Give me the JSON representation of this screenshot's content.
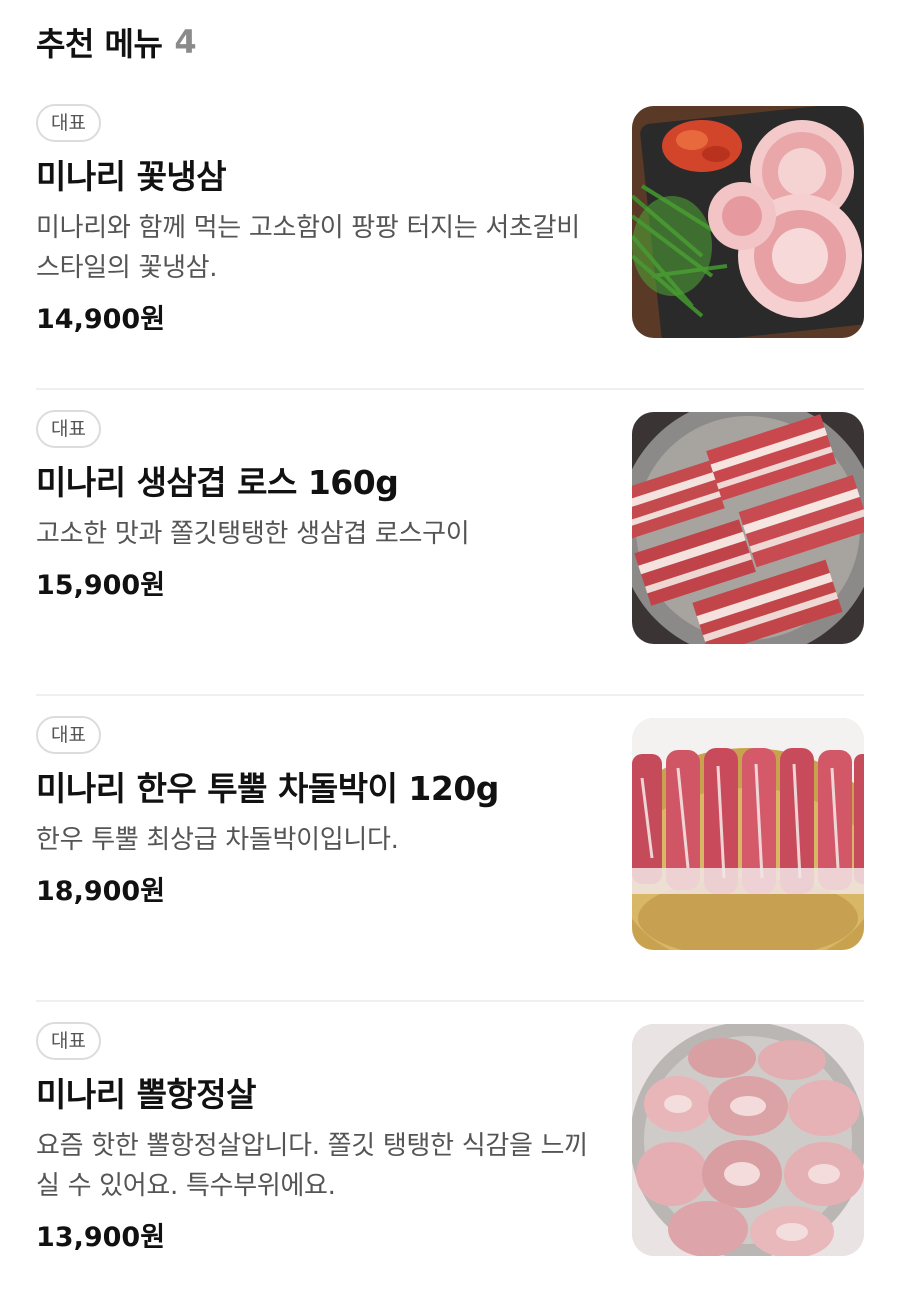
{
  "section": {
    "title": "추천 메뉴",
    "count": "4"
  },
  "menus": [
    {
      "badge": "대표",
      "name": "미나리 꽃냉삼",
      "desc": "미나리와 함께 먹는 고소함이 팡팡 터지는 서초갈비 스타일의 꽃냉삼.",
      "price": "14,900원",
      "image": "sliced-pork-with-minari-photo"
    },
    {
      "badge": "대표",
      "name": "미나리 생삼겹 로스 160g",
      "desc": "고소한 맛과 쫄깃탱탱한 생삼겹 로스구이",
      "price": "15,900원",
      "image": "pork-belly-photo"
    },
    {
      "badge": "대표",
      "name": "미나리 한우 투뿔 차돌박이 120g",
      "desc": "한우 투뿔 최상급 차돌박이입니다.",
      "price": "18,900원",
      "image": "beef-brisket-photo"
    },
    {
      "badge": "대표",
      "name": "미나리 뽈항정살",
      "desc": "요즘 핫한 뽈항정살압니다. 쫄깃 탱탱한 식감을 느끼실 수 있어요. 특수부위에요.",
      "price": "13,900원",
      "image": "pork-jowl-photo"
    }
  ]
}
